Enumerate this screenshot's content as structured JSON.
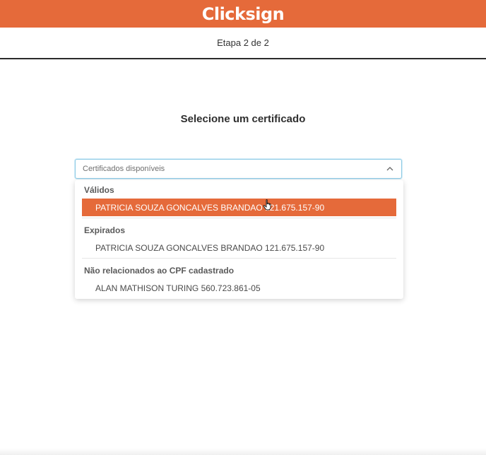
{
  "header": {
    "brand": "Clicksign"
  },
  "step": {
    "label": "Etapa 2 de 2"
  },
  "main": {
    "title": "Selecione um certificado"
  },
  "select": {
    "placeholder": "Certificados disponíveis",
    "expanded": true,
    "groups": [
      {
        "label": "Válidos",
        "options": [
          "PATRICIA SOUZA GONCALVES BRANDAO 121.675.157-90"
        ]
      },
      {
        "label": "Expirados",
        "options": [
          "PATRICIA SOUZA GONCALVES BRANDAO 121.675.157-90"
        ]
      },
      {
        "label": "Não relacionados ao CPF cadastrado",
        "options": [
          "ALAN MATHISON TURING 560.723.861-05"
        ]
      }
    ],
    "highlighted": "PATRICIA SOUZA GONCALVES BRANDAO 121.675.157-90"
  },
  "colors": {
    "brand": "#e56a3a",
    "focus_border": "#8fcbe5",
    "text": "#3a3a3a"
  },
  "icons": {
    "select_toggle": "chevron-up-icon",
    "pointer": "hand-cursor-icon"
  }
}
